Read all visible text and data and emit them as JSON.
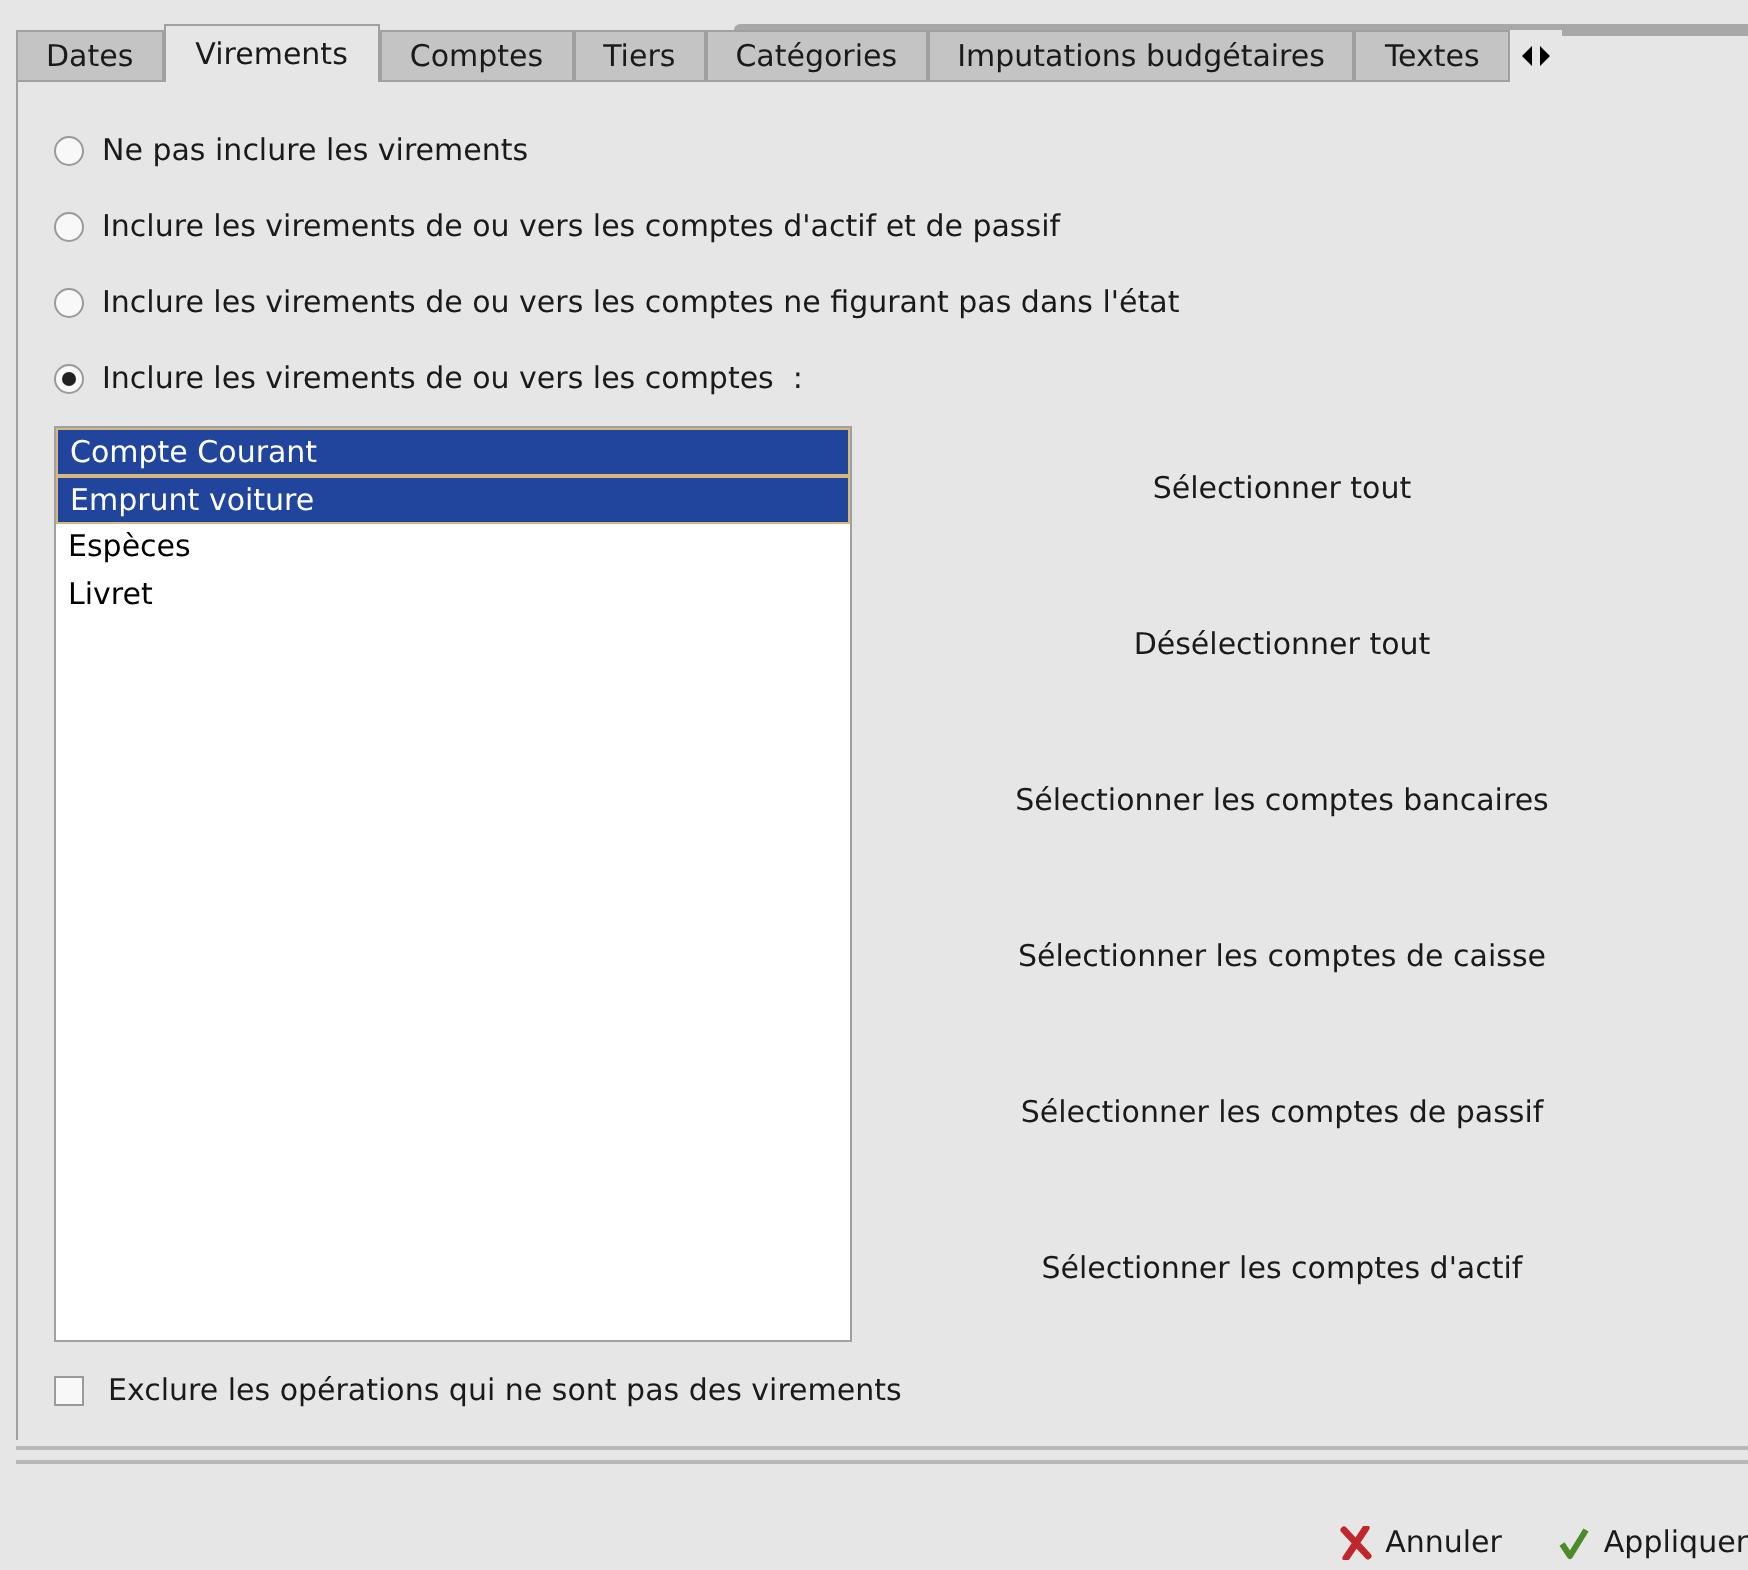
{
  "tabs": [
    {
      "label": "Dates",
      "selected": false
    },
    {
      "label": "Virements",
      "selected": true
    },
    {
      "label": "Comptes",
      "selected": false
    },
    {
      "label": "Tiers",
      "selected": false
    },
    {
      "label": "Catégories",
      "selected": false
    },
    {
      "label": "Imputations budgétaires",
      "selected": false
    },
    {
      "label": "Textes",
      "selected": false
    }
  ],
  "options": [
    {
      "label": "Ne pas inclure les virements",
      "selected": false
    },
    {
      "label": "Inclure les virements de ou vers les comptes d'actif et de passif",
      "selected": false
    },
    {
      "label": "Inclure les virements de ou vers les comptes ne figurant pas dans l'état",
      "selected": false
    },
    {
      "label": "Inclure les virements de ou vers les comptes  :",
      "selected": true
    }
  ],
  "accounts": [
    {
      "name": "Compte Courant",
      "selected": true
    },
    {
      "name": "Emprunt voiture",
      "selected": true
    },
    {
      "name": "Espèces",
      "selected": false
    },
    {
      "name": "Livret",
      "selected": false
    }
  ],
  "selection_buttons": [
    "Sélectionner tout",
    "Désélectionner tout",
    "Sélectionner les comptes bancaires",
    "Sélectionner les comptes de caisse",
    "Sélectionner les comptes de passif",
    "Sélectionner les comptes d'actif"
  ],
  "exclude": {
    "label": "Exclure les opérations qui ne sont pas des virements",
    "checked": false
  },
  "buttons": [
    {
      "kind": "cancel",
      "label": "Annuler"
    },
    {
      "kind": "apply",
      "label": "Appliquer"
    }
  ]
}
